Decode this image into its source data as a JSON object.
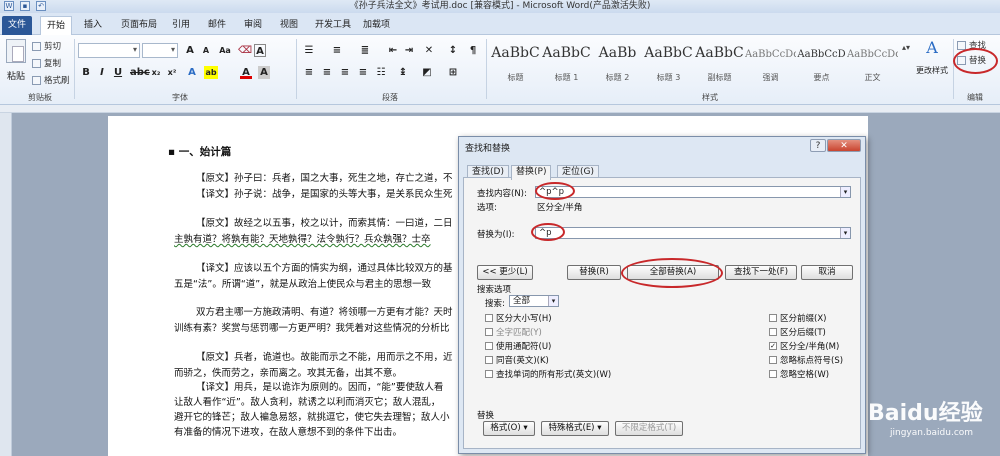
{
  "titlebar": {
    "title": "《孙子兵法全文》考试用.doc [兼容模式] - Microsoft Word(产品激活失败)"
  },
  "tabs": [
    "文件",
    "开始",
    "插入",
    "页面布局",
    "引用",
    "邮件",
    "审阅",
    "视图",
    "开发工具",
    "加载项"
  ],
  "clipboard": {
    "paste": "粘贴",
    "cut": "剪切",
    "copy": "复制",
    "format_painter": "格式刷",
    "label": "剪贴板"
  },
  "font": {
    "label": "字体",
    "bold": "B",
    "italic": "I",
    "underline": "U",
    "font_color": "A"
  },
  "paragraph": {
    "label": "段落"
  },
  "styles": {
    "label": "样式",
    "items": [
      {
        "sample": "AaBbC",
        "name": "标题"
      },
      {
        "sample": "AaBbC",
        "name": "标题 1"
      },
      {
        "sample": "AaBb",
        "name": "标题 2"
      },
      {
        "sample": "AaBbC",
        "name": "标题 3"
      },
      {
        "sample": "AaBbC",
        "name": "副标题"
      },
      {
        "sample": "AaBbCcDd",
        "name": "强调"
      },
      {
        "sample": "AaBbCcD",
        "name": "要点"
      },
      {
        "sample": "AaBbCcDd",
        "name": "正文"
      }
    ],
    "change_styles": "更改样式"
  },
  "editing": {
    "find": "查找",
    "replace": "替换",
    "label": "编辑"
  },
  "document": {
    "heading": "▪ 一、始计篇",
    "lines": [
      "【原文】孙子曰：兵者，国之大事，死生之地，存亡之道，不",
      "【译文】孙子说：战争，是国家的头等大事，是关系民众生死",
      "【原文】故经之以五事，校之以计，而索其情：一曰道，二日",
      "主孰有道？将孰有能？天地孰得？法令孰行？兵众孰强？士卒",
      "【译文】应该以五个方面的情实为纲，通过具体比较双方的基",
      "五是“法”。所谓“道”，就是从政治上使民众与君主的思想一致",
      "双方君主哪一方施政清明、有道？将领哪一方更有才能？天时",
      "训练有素？奖赏与惩罚哪一方更严明？我凭着对这些情况的分析比",
      "【原文】兵者，诡道也。故能而示之不能，用而示之不用，近",
      "而骄之，佚而劳之，亲而离之。攻其无备，出其不意。",
      "【译文】用兵，是以诡诈为原则的。因而，“能”要使敌人看",
      "让敌人看作“近”。敌人贪利，就诱之以利而消灭它；敌人混乱，",
      "避开它的锋芒；敌人褊急易怒，就挑逗它，使它失去理智；敌人小",
      "有准备的情况下进攻，在敌人意想不到的条件下出击。"
    ]
  },
  "dialog": {
    "title": "查找和替换",
    "help": "?",
    "close": "✕",
    "tabs": [
      "查找(D)",
      "替换(P)",
      "定位(G)"
    ],
    "find_label": "查找内容(N):",
    "find_value": "^p^p",
    "options_label": "选项:",
    "options_value": "区分全/半角",
    "replace_label": "替换为(I):",
    "replace_value": "^p",
    "buttons": {
      "less": "<< 更少(L)",
      "replace": "替换(R)",
      "replace_all": "全部替换(A)",
      "find_next": "查找下一处(F)",
      "cancel": "取消"
    },
    "search_options_label": "搜索选项",
    "search_label": "搜索:",
    "search_value": "全部",
    "left_checks": [
      "区分大小写(H)",
      "全字匹配(Y)",
      "使用通配符(U)",
      "同音(英文)(K)",
      "查找单词的所有形式(英文)(W)"
    ],
    "right_checks": [
      "区分前缀(X)",
      "区分后缀(T)",
      "区分全/半角(M)",
      "忽略标点符号(S)",
      "忽略空格(W)"
    ],
    "replace_section": "替换",
    "bottom_buttons": [
      "格式(O) ▾",
      "特殊格式(E) ▾",
      "不限定格式(T)"
    ]
  },
  "watermark": {
    "brand": "Baidu经验",
    "url": "jingyan.baidu.com"
  }
}
